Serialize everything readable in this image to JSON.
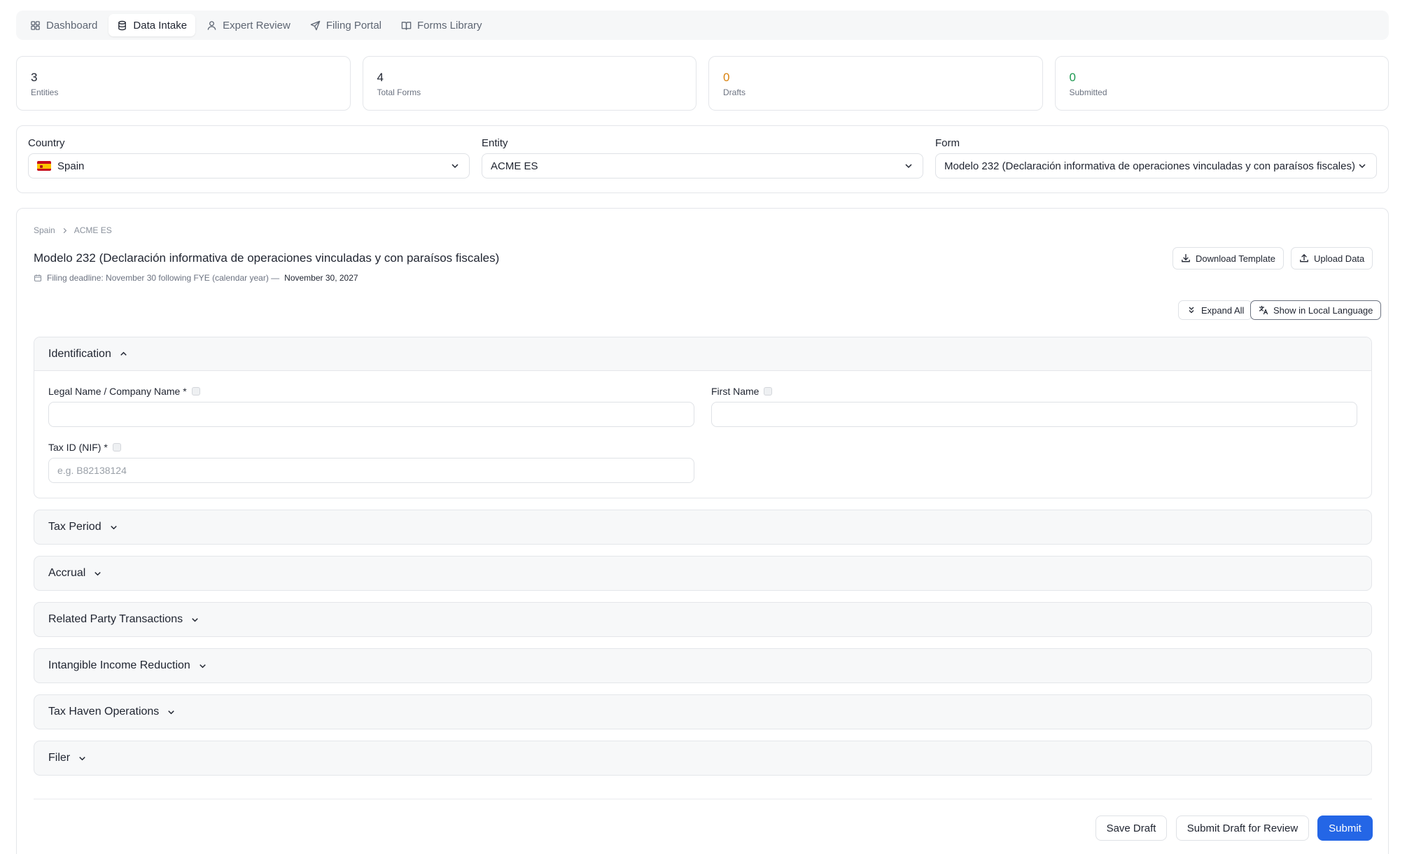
{
  "nav": {
    "tabs": [
      {
        "label": "Dashboard",
        "icon": "grid-icon"
      },
      {
        "label": "Data Intake",
        "icon": "database-icon",
        "active": true
      },
      {
        "label": "Expert Review",
        "icon": "user-icon"
      },
      {
        "label": "Filing Portal",
        "icon": "send-icon"
      },
      {
        "label": "Forms Library",
        "icon": "book-icon"
      }
    ]
  },
  "stats": [
    {
      "value": "3",
      "label": "Entities"
    },
    {
      "value": "4",
      "label": "Total Forms"
    },
    {
      "value": "0",
      "label": "Drafts",
      "color": "#d9820f"
    },
    {
      "value": "0",
      "label": "Submitted",
      "color": "#1f9a52"
    }
  ],
  "selectors": {
    "country": {
      "label": "Country",
      "value": "Spain"
    },
    "entity": {
      "label": "Entity",
      "value": "ACME ES"
    },
    "form": {
      "label": "Form",
      "value": "Modelo 232 (Declaración informativa de operaciones vinculadas y con paraísos fiscales)"
    }
  },
  "main": {
    "breadcrumb": [
      "Spain",
      "ACME ES"
    ],
    "title": "Modelo 232 (Declaración informativa de operaciones vinculadas y con paraísos fiscales)",
    "deadline_text": "Filing deadline: November 30 following FYE (calendar year) —",
    "deadline_date": "November 30, 2027",
    "download_label": "Download Template",
    "upload_label": "Upload Data",
    "expand_label": "Expand All",
    "local_label": "Show in Local Language"
  },
  "sections": [
    {
      "title": "Identification",
      "open": true
    },
    {
      "title": "Tax Period"
    },
    {
      "title": "Accrual"
    },
    {
      "title": "Related Party Transactions"
    },
    {
      "title": "Intangible Income Reduction"
    },
    {
      "title": "Tax Haven Operations"
    },
    {
      "title": "Filer"
    }
  ],
  "fields": {
    "legal_name": {
      "label": "Legal Name / Company Name *",
      "value": "",
      "placeholder": ""
    },
    "first_name": {
      "label": "First Name",
      "value": "",
      "placeholder": ""
    },
    "tax_id": {
      "label": "Tax ID (NIF) *",
      "value": "",
      "placeholder": "e.g. B82138124"
    }
  },
  "footer": {
    "save_label": "Save Draft",
    "review_label": "Submit Draft for Review",
    "submit_label": "Submit"
  },
  "colors": {
    "primary": "#2466e6",
    "drafts": "#d9820f",
    "submitted": "#1f9a52"
  }
}
